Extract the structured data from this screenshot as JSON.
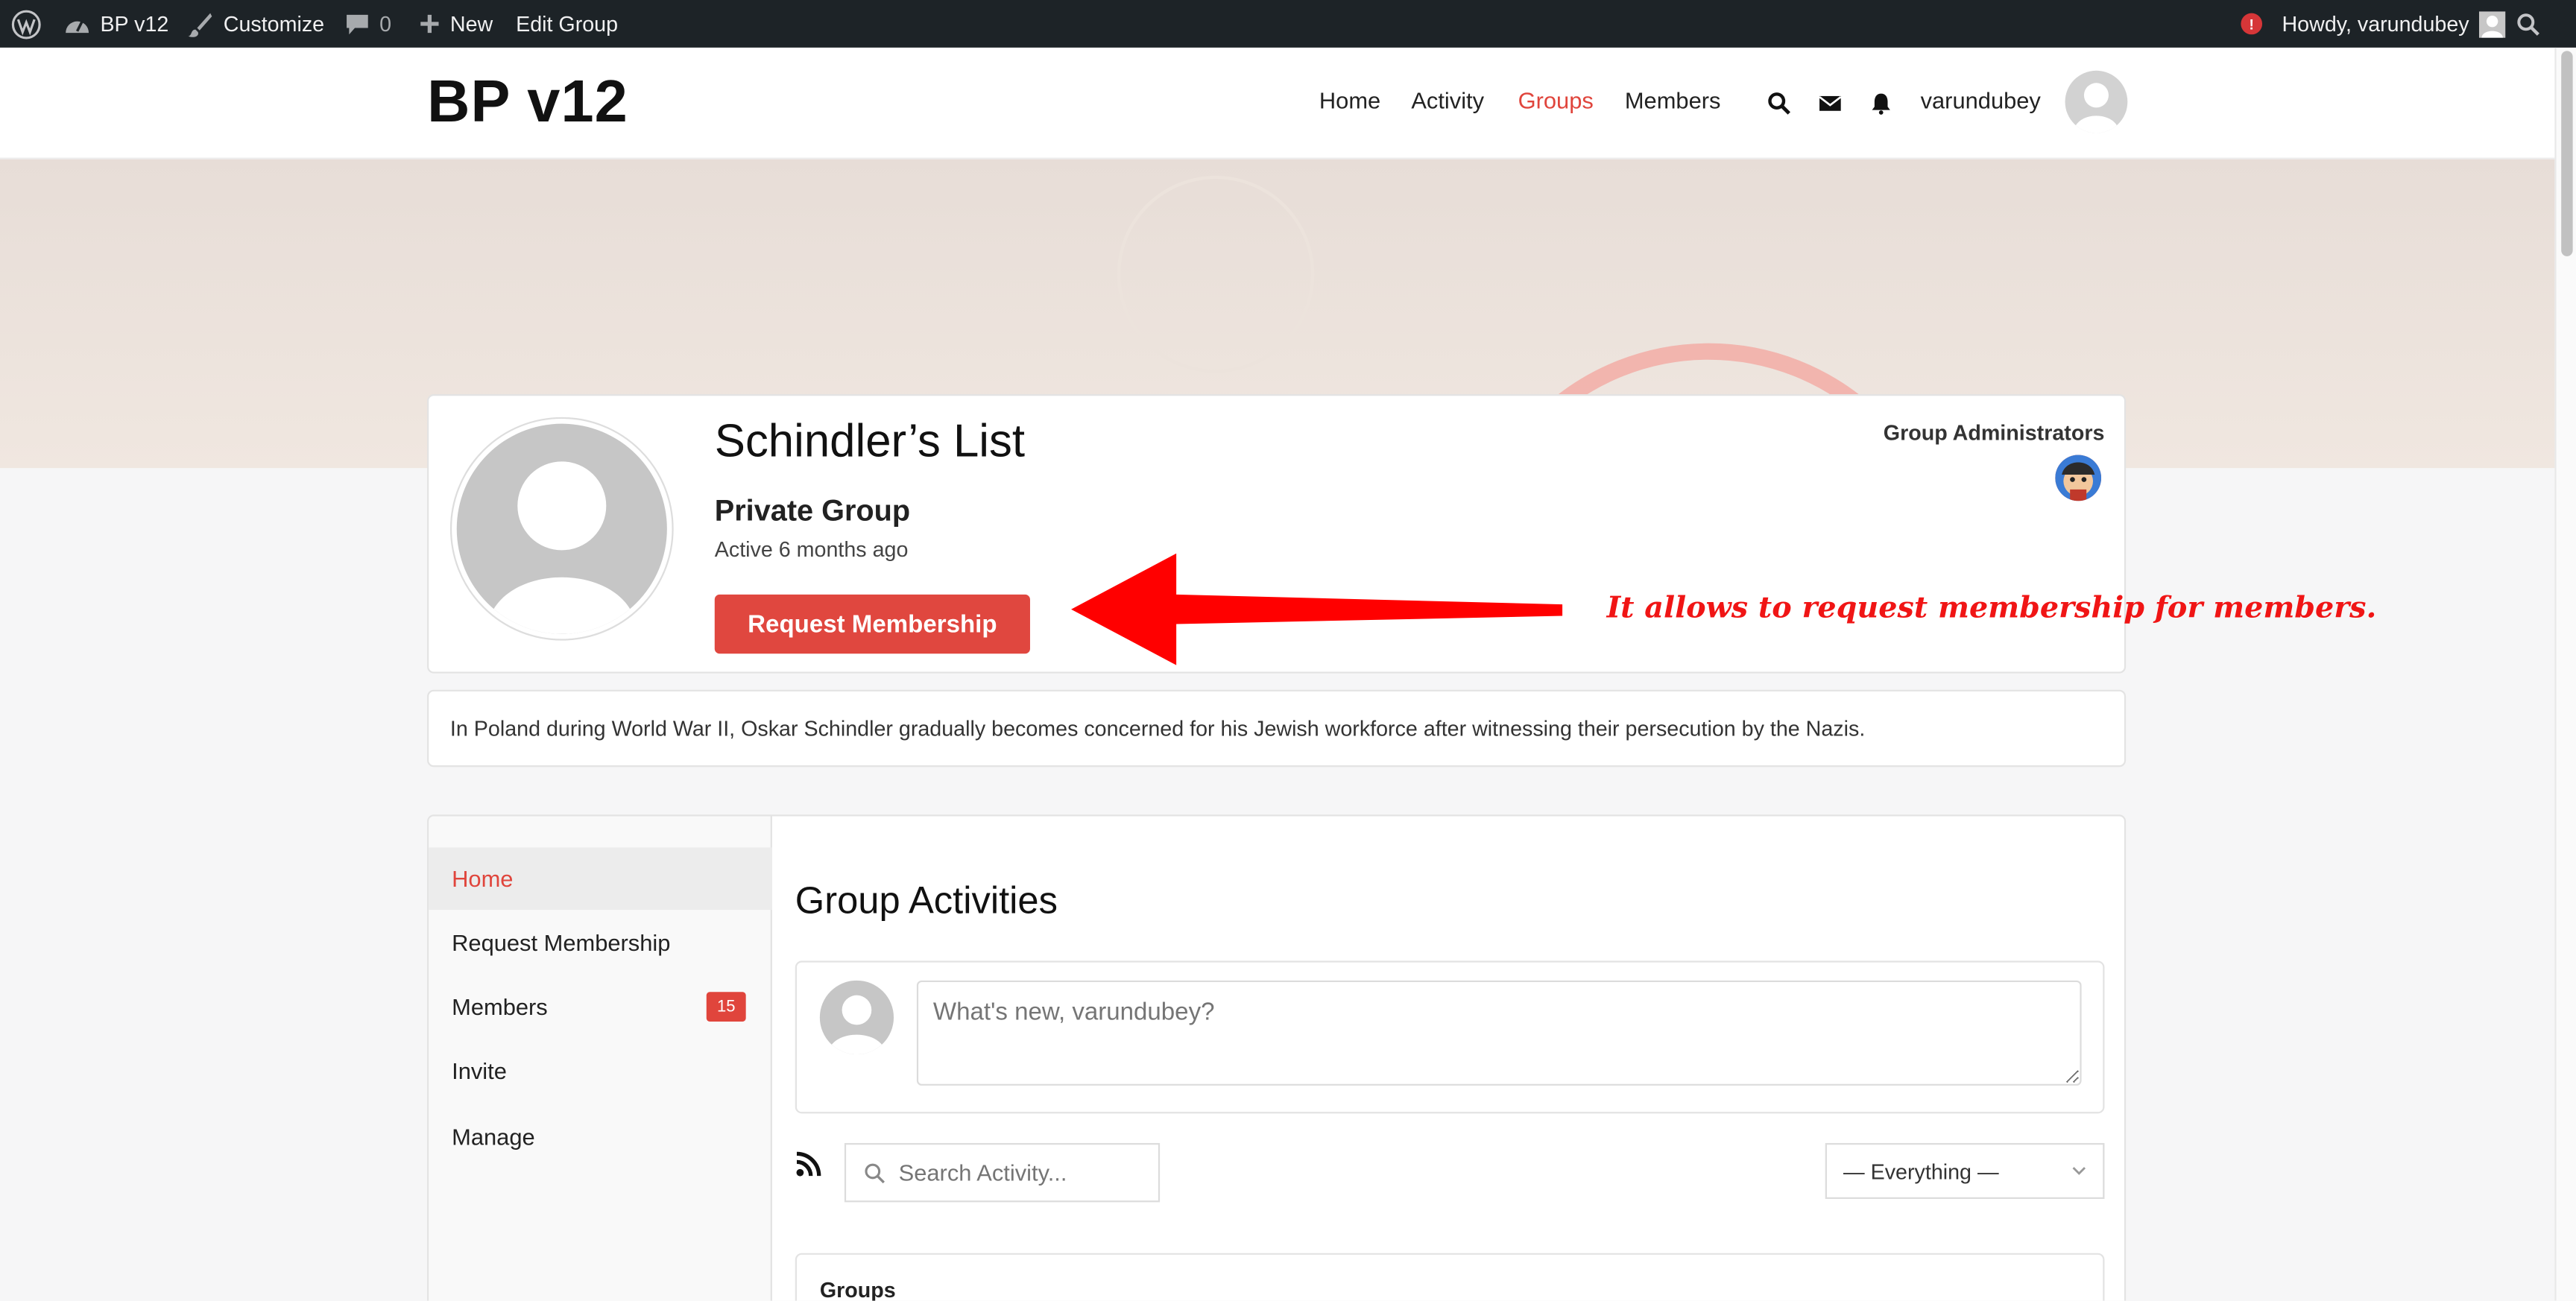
{
  "admin_bar": {
    "wp_logo_icon": "wordpress-icon",
    "site_name": "BP v12",
    "customize": "Customize",
    "comments_count": "0",
    "new_label": "New",
    "edit_group": "Edit Group",
    "notice_badge": "!",
    "howdy": "Howdy, varundubey"
  },
  "header": {
    "site_title": "BP v12",
    "nav": [
      "Home",
      "Activity",
      "Groups",
      "Members"
    ],
    "active_nav": "Groups",
    "username": "varundubey"
  },
  "group": {
    "name": "Schindler’s List",
    "type": "Private Group",
    "last_active": "Active 6 months ago",
    "request_button": "Request Membership",
    "admins_label": "Group Administrators",
    "description": "In Poland during World War II, Oskar Schindler gradually becomes concerned for his Jewish workforce after witnessing their persecution by the Nazis."
  },
  "annotation": {
    "text": "It allows to request membership for members.",
    "color": "#f01515"
  },
  "group_nav": {
    "items": [
      {
        "label": "Home",
        "active": true
      },
      {
        "label": "Request Membership"
      },
      {
        "label": "Members",
        "count": "15"
      },
      {
        "label": "Invite"
      },
      {
        "label": "Manage"
      }
    ]
  },
  "activity": {
    "title": "Group Activities",
    "post_placeholder": "What's new, varundubey?",
    "search_placeholder": "Search Activity...",
    "filter_selected": "— Everything —",
    "first_card_title": "Groups"
  },
  "colors": {
    "accent": "#e0453c",
    "admin_bar": "#1d2327"
  }
}
